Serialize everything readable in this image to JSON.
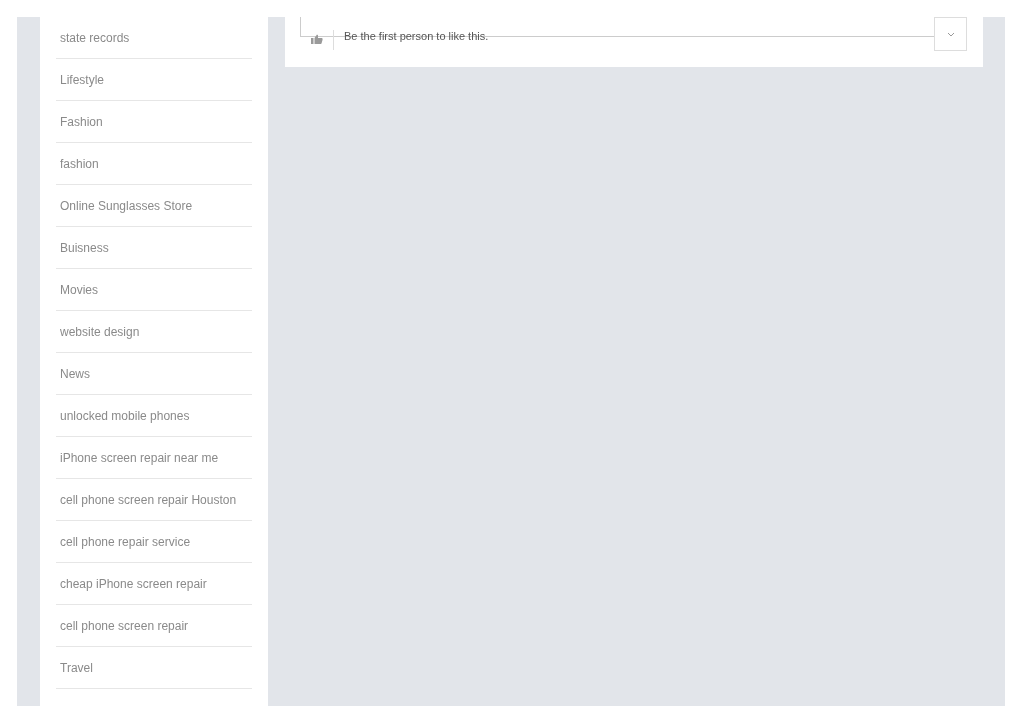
{
  "sidebar": {
    "items": [
      {
        "label": "state records"
      },
      {
        "label": "Lifestyle"
      },
      {
        "label": "Fashion"
      },
      {
        "label": "fashion"
      },
      {
        "label": "Online Sunglasses Store"
      },
      {
        "label": "Buisness"
      },
      {
        "label": "Movies"
      },
      {
        "label": "website design"
      },
      {
        "label": "News"
      },
      {
        "label": "unlocked mobile phones"
      },
      {
        "label": "iPhone screen repair near me"
      },
      {
        "label": "cell phone screen repair Houston"
      },
      {
        "label": "cell phone repair service"
      },
      {
        "label": "cheap iPhone screen repair"
      },
      {
        "label": "cell phone screen repair"
      },
      {
        "label": "Travel"
      }
    ]
  },
  "like_bar": {
    "text": "Be the first person to like this."
  }
}
